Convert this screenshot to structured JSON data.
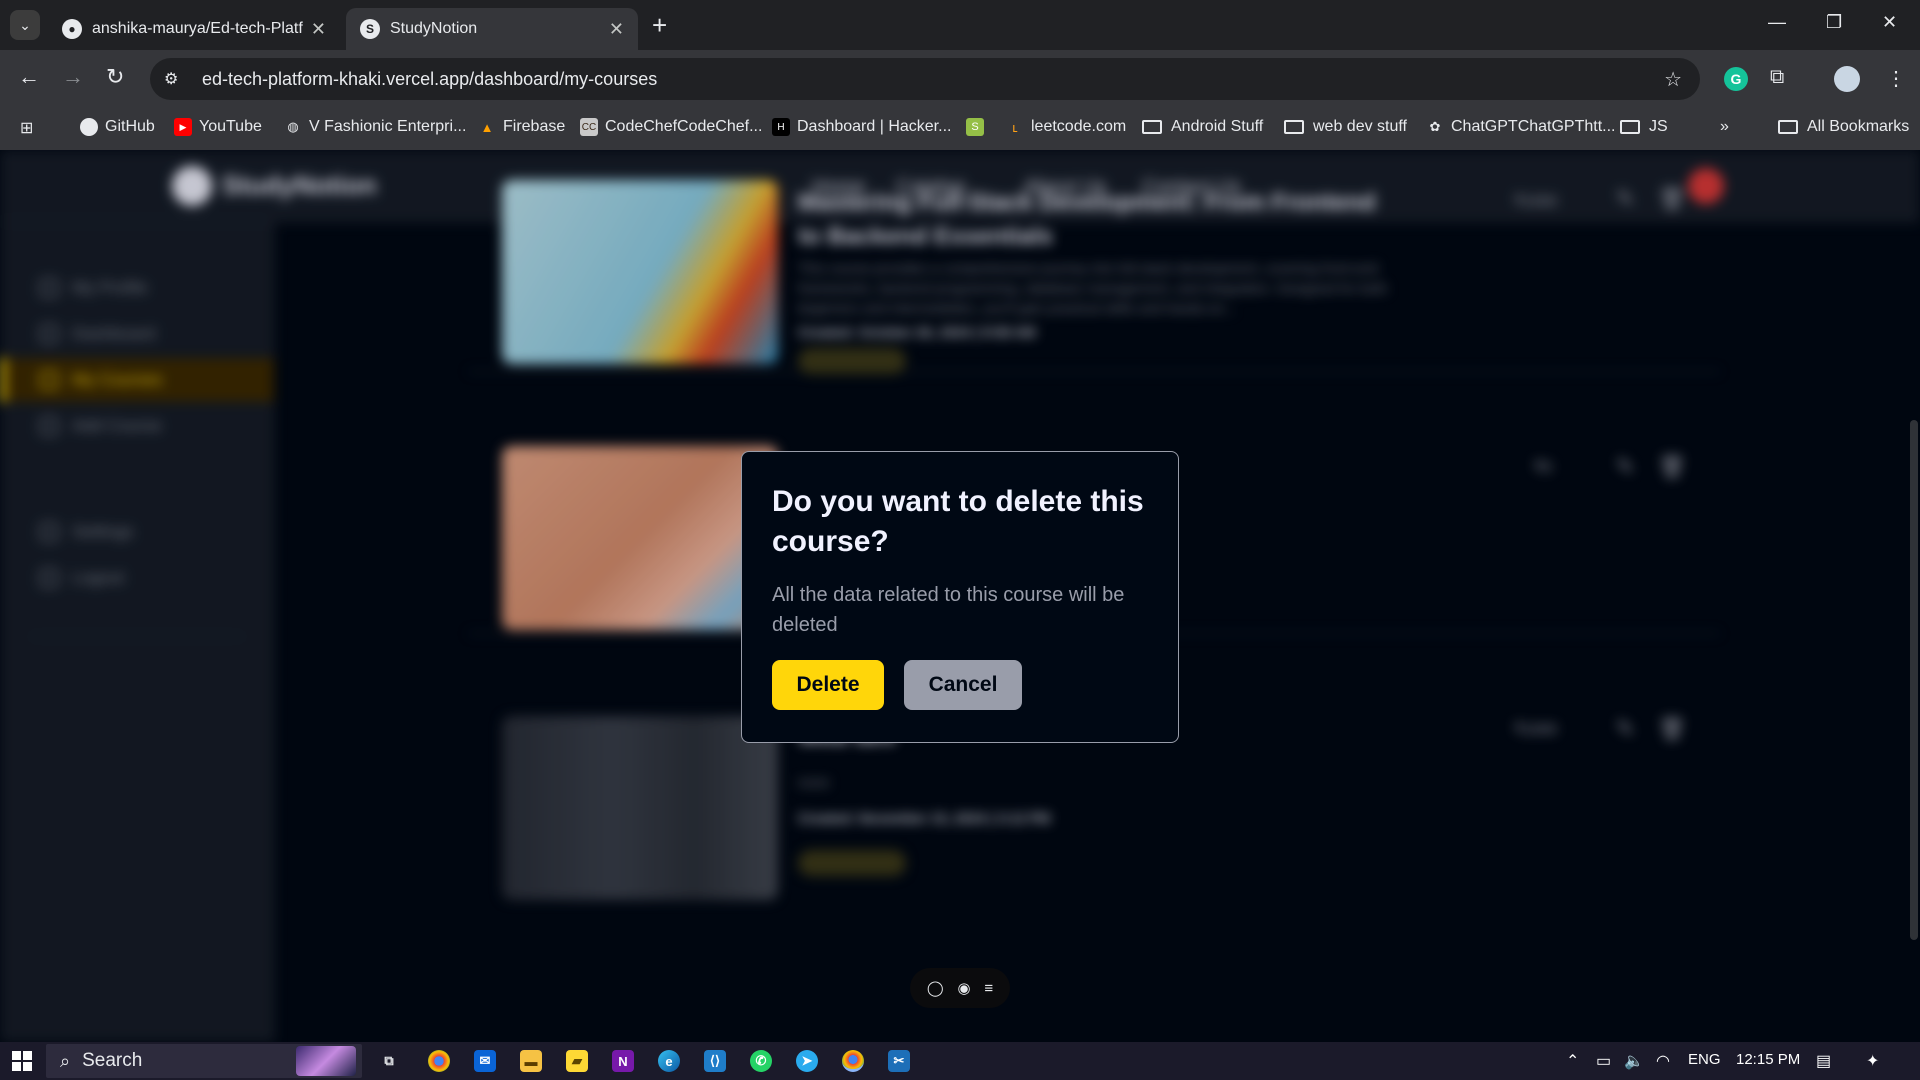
{
  "browser": {
    "tabs": [
      {
        "title": "anshika-maurya/Ed-tech-Platfo",
        "icon": "github-icon",
        "active": false
      },
      {
        "title": "StudyNotion",
        "icon": "studynotion-icon",
        "active": true
      }
    ],
    "url": "ed-tech-platform-khaki.vercel.app/dashboard/my-courses",
    "bookmarks": [
      {
        "label": "GitHub",
        "icon": "github-icon"
      },
      {
        "label": "YouTube",
        "icon": "youtube-icon"
      },
      {
        "label": "V Fashionic Enterpri...",
        "icon": "globe-icon"
      },
      {
        "label": "Firebase",
        "icon": "firebase-icon"
      },
      {
        "label": "CodeChefCodeChef...",
        "icon": "codechef-icon"
      },
      {
        "label": "Dashboard | Hacker...",
        "icon": "hackerrank-icon"
      },
      {
        "label": "",
        "icon": "shopify-icon"
      },
      {
        "label": "leetcode.com",
        "icon": "leetcode-icon"
      },
      {
        "label": "Android Stuff",
        "icon": "folder-icon"
      },
      {
        "label": "web dev stuff",
        "icon": "folder-icon"
      },
      {
        "label": "ChatGPTChatGPThtt...",
        "icon": "chatgpt-icon"
      },
      {
        "label": "JS",
        "icon": "folder-icon"
      }
    ],
    "all_bookmarks": "All Bookmarks"
  },
  "site": {
    "logo": "StudyNotion",
    "nav": [
      "Home",
      "Catalog",
      "About Us",
      "Contact Us"
    ],
    "sidebar": [
      "My Profile",
      "Dashboard",
      "My Courses",
      "Add Course",
      "Settings",
      "Logout"
    ],
    "courses": [
      {
        "title": "Mastering Full-Stack Development: From Frontend to Backend Essentials",
        "description": "This course provides a comprehensive journey into full-stack development, covering front-end frameworks, backend programming, database management, and integration. Designed for both beginners and intermediates, you'll gain practical skills and hands-on...",
        "created": "Created: October 26, 2024 | 9:58 AM",
        "status": "Published",
        "price": "₹1500"
      },
      {
        "title": "",
        "description": "",
        "created": "",
        "status": "",
        "price": "₹0"
      },
      {
        "title": "Web dev",
        "description": "none",
        "created": "Created: November 15, 2024 | 3:12 PM",
        "status": "Published",
        "price": "₹1000"
      }
    ]
  },
  "modal": {
    "title": "Do you want to delete this course?",
    "text": "All the data related to this course will be deleted",
    "delete_label": "Delete",
    "cancel_label": "Cancel"
  },
  "taskbar": {
    "search_label": "Search",
    "language": "ENG",
    "time": "12:15 PM"
  },
  "colors": {
    "accent": "#ffd60a",
    "page_bg": "#000814",
    "modal_border": "#999daa"
  }
}
